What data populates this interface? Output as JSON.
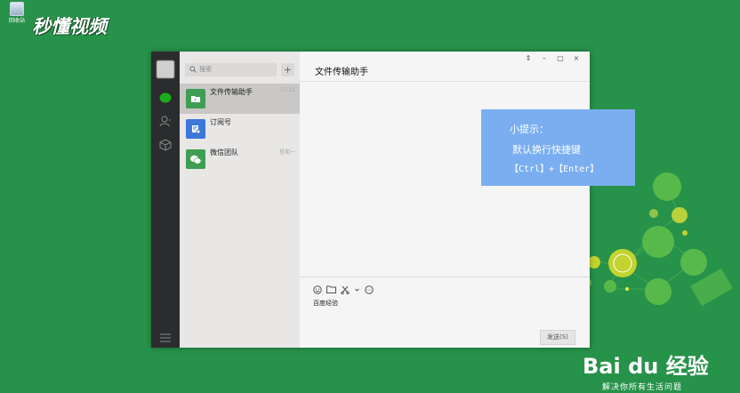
{
  "desktop": {
    "icon_label": "回收站",
    "logo_text": "秒懂视频"
  },
  "window": {
    "search": {
      "placeholder": "搜索"
    },
    "add_label": "+",
    "chats": [
      {
        "name": "文件传输助手",
        "time": "17:22"
      },
      {
        "name": "订阅号",
        "time": ""
      },
      {
        "name": "微信团队",
        "time": "星期一"
      }
    ],
    "title": "文件传输助手",
    "controls": {
      "pin": "⇕",
      "minimize": "–",
      "maximize": "□",
      "close": "×"
    },
    "input_text": "百度经验",
    "send_label": "发送(S)"
  },
  "tip": {
    "title": "小提示：",
    "line1": "默认换行快捷键",
    "line2": "【Ctrl】+【Enter】"
  },
  "watermark": {
    "brand": "Bai du 经验",
    "slogan": "解决你所有生活问题"
  },
  "colors": {
    "background": "#27924a",
    "rail": "#2b2c2e",
    "list": "#e8e7e6",
    "tip": "#7aaef0",
    "accent": "#1aad19"
  }
}
